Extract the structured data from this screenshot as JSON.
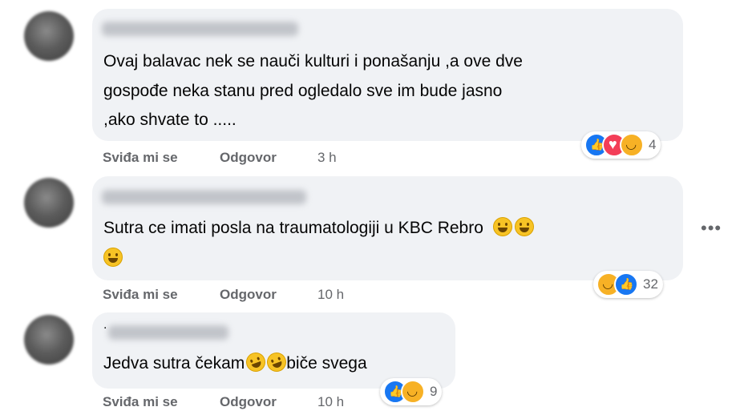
{
  "comments": [
    {
      "lines": [
        "Ovaj balavac nek se nauči kulturi i ponašanju ,a ove dve",
        "gospođe neka stanu pred ogledalo sve im bude jasno",
        ",ako shvate to ....."
      ],
      "like_label": "Sviđa mi se",
      "reply_label": "Odgovor",
      "time": "3 h",
      "reactions": [
        "like-icon",
        "love-icon",
        "haha-icon"
      ],
      "reaction_count": "4"
    },
    {
      "lines": [
        "Sutra ce imati posla na traumatologiji u KBC Rebro"
      ],
      "like_label": "Sviđa mi se",
      "reply_label": "Odgovor",
      "time": "10 h",
      "reactions": [
        "haha-icon",
        "like-icon"
      ],
      "reaction_count": "32"
    },
    {
      "dot": ".",
      "text_a": "Jedva sutra čekam",
      "text_b": "biče svega",
      "like_label": "Sviđa mi se",
      "reply_label": "Odgovor",
      "time": "10 h",
      "reactions": [
        "like-icon",
        "haha-icon"
      ],
      "reaction_count": "9"
    }
  ],
  "more_options": "•••",
  "icons": {
    "emoji": "grinning-emoji-icon",
    "laugh": "rolling-laughing-emoji-icon"
  }
}
